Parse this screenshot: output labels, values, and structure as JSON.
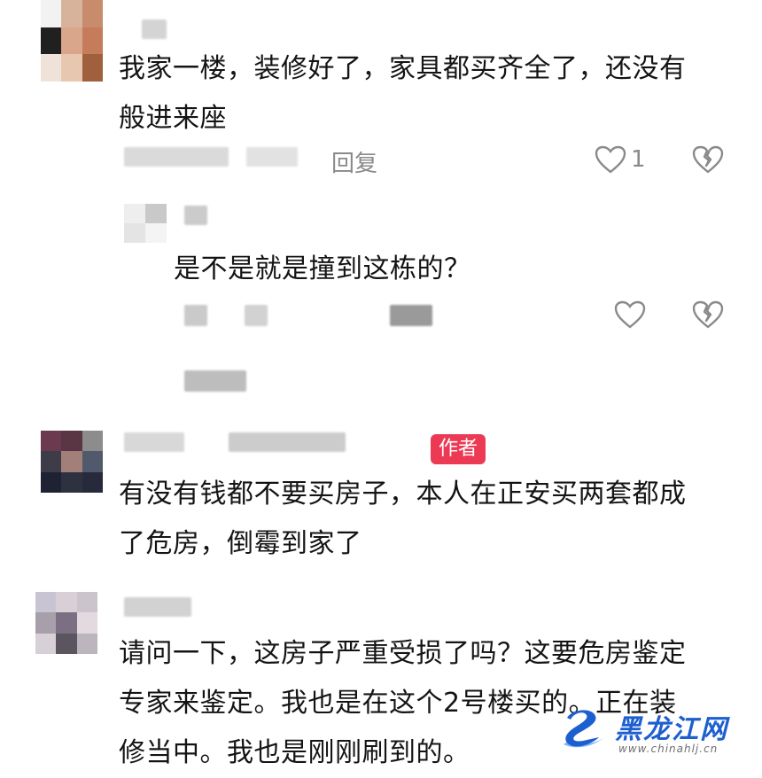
{
  "comments": [
    {
      "text_line1": "我家一楼，装修好了，家具都买齐全了，还没有",
      "text_line2": "般进来座",
      "reply_label": "回复",
      "like_count": "1",
      "colors": [
        "#1a1a1a",
        "#d9a68c",
        "#c47c5a",
        "#efe2d8",
        "#2f2a28",
        "#e8c7b0"
      ]
    },
    {
      "is_reply": true,
      "text": "是不是就是撞到这栋的？"
    },
    {
      "author_badge": "作者",
      "text_line1": "有没有钱都不要买房子，本人在正安买两套都成",
      "text_line2": "了危房，倒霉到家了",
      "colors": [
        "#6b3a4e",
        "#3e3c49",
        "#a37f7a",
        "#2e3140",
        "#515a6d",
        "#1f2233"
      ]
    },
    {
      "text_line1": "请问一下，这房子严重受损了吗？这要危房鉴定",
      "text_line2": "专家来鉴定。我也是在这个2号楼买的。正在装",
      "text_line3": "修当中。我也是刚刚刷到的。",
      "colors": [
        "#c8c4d4",
        "#7c6f84",
        "#d9cfd6",
        "#a7a0ab",
        "#5b5560",
        "#cbc4cd"
      ]
    }
  ],
  "watermark": {
    "title": "黑龙江网",
    "url": "www.chinahlj.cn",
    "accent": "#1e5fcf"
  }
}
